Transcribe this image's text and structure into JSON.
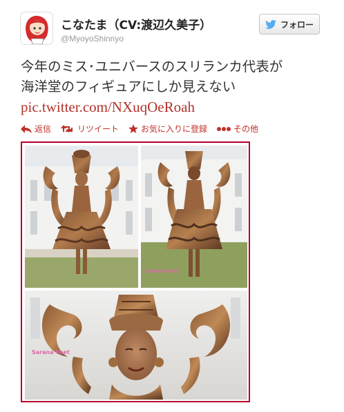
{
  "user": {
    "display_name": "こなたま（CV:渡辺久美子）",
    "handle": "@MyoyoShinnyo"
  },
  "follow_button": {
    "label": "フォロー",
    "icon": "twitter-bird-icon"
  },
  "tweet": {
    "line1": "今年のミス･ユニバースのスリランカ代表が",
    "line2": "海洋堂のフィギュアにしか見えない",
    "link": "pic.twitter.com/NXuqOeRoah"
  },
  "actions": [
    {
      "icon": "reply-icon",
      "label": "返信"
    },
    {
      "icon": "retweet-icon",
      "label": "リツイート"
    },
    {
      "icon": "star-icon",
      "label": "お気に入りに登録"
    },
    {
      "icon": "more-icon",
      "label": "その他"
    }
  ],
  "colors": {
    "link": "#b0322a",
    "action": "#c0302a",
    "frame": "#b5002a",
    "follow_icon": "#55acee"
  },
  "photo": {
    "watermark": "Sarana Veet"
  }
}
